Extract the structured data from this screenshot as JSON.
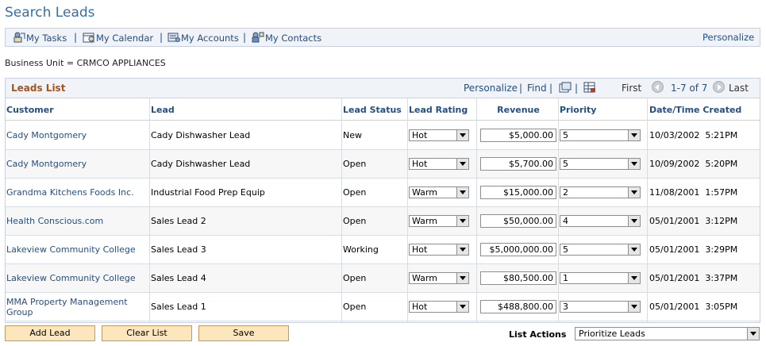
{
  "page_title": "Search Leads",
  "toolbar": {
    "items": [
      {
        "label": "My Tasks",
        "icon": "tasks-icon"
      },
      {
        "label": "My Calendar",
        "icon": "calendar-icon"
      },
      {
        "label": "My Accounts",
        "icon": "accounts-icon"
      },
      {
        "label": "My Contacts",
        "icon": "contacts-icon"
      }
    ],
    "separator": "|",
    "personalize": "Personalize"
  },
  "business_unit": "Business Unit = CRMCO APPLIANCES",
  "grid": {
    "title": "Leads List",
    "personalize": "Personalize",
    "find": "Find",
    "sep": "|",
    "first": "First",
    "range": "1-7 of 7",
    "last": "Last",
    "columns": [
      "Customer",
      "Lead",
      "Lead Status",
      "Lead Rating",
      "Revenue",
      "Priority",
      "Date/Time Created"
    ],
    "rows": [
      {
        "customer": "Cady Montgomery",
        "lead": "Cady Dishwasher Lead",
        "status": "New",
        "rating": "Hot",
        "revenue": "$5,000.00",
        "priority": "5",
        "created": "10/03/2002  5:21PM"
      },
      {
        "customer": "Cady Montgomery",
        "lead": "Cady Dishwasher Lead",
        "status": "Open",
        "rating": "Hot",
        "revenue": "$5,700.00",
        "priority": "5",
        "created": "10/09/2002  5:20PM"
      },
      {
        "customer": "Grandma Kitchens Foods Inc.",
        "lead": "Industrial Food Prep Equip",
        "status": "Open",
        "rating": "Warm",
        "revenue": "$15,000.00",
        "priority": "2",
        "created": "11/08/2001  1:57PM"
      },
      {
        "customer": "Health Conscious.com",
        "lead": "Sales Lead 2",
        "status": "Open",
        "rating": "Warm",
        "revenue": "$50,000.00",
        "priority": "4",
        "created": "05/01/2001  3:12PM"
      },
      {
        "customer": "Lakeview Community College",
        "lead": "Sales Lead 3",
        "status": "Working",
        "rating": "Hot",
        "revenue": "$5,000,000.00",
        "priority": "5",
        "created": "05/01/2001  3:29PM"
      },
      {
        "customer": "Lakeview Community College",
        "lead": "Sales Lead 4",
        "status": "Open",
        "rating": "Warm",
        "revenue": "$80,500.00",
        "priority": "1",
        "created": "05/01/2001  3:37PM"
      },
      {
        "customer": "MMA Property Management Group",
        "lead": "Sales Lead 1",
        "status": "Open",
        "rating": "Hot",
        "revenue": "$488,800.00",
        "priority": "3",
        "created": "05/01/2001  3:05PM"
      }
    ]
  },
  "buttons": {
    "add_lead": "Add Lead",
    "clear_list": "Clear List",
    "save": "Save"
  },
  "list_actions": {
    "label": "List Actions",
    "value": "Prioritize Leads"
  }
}
